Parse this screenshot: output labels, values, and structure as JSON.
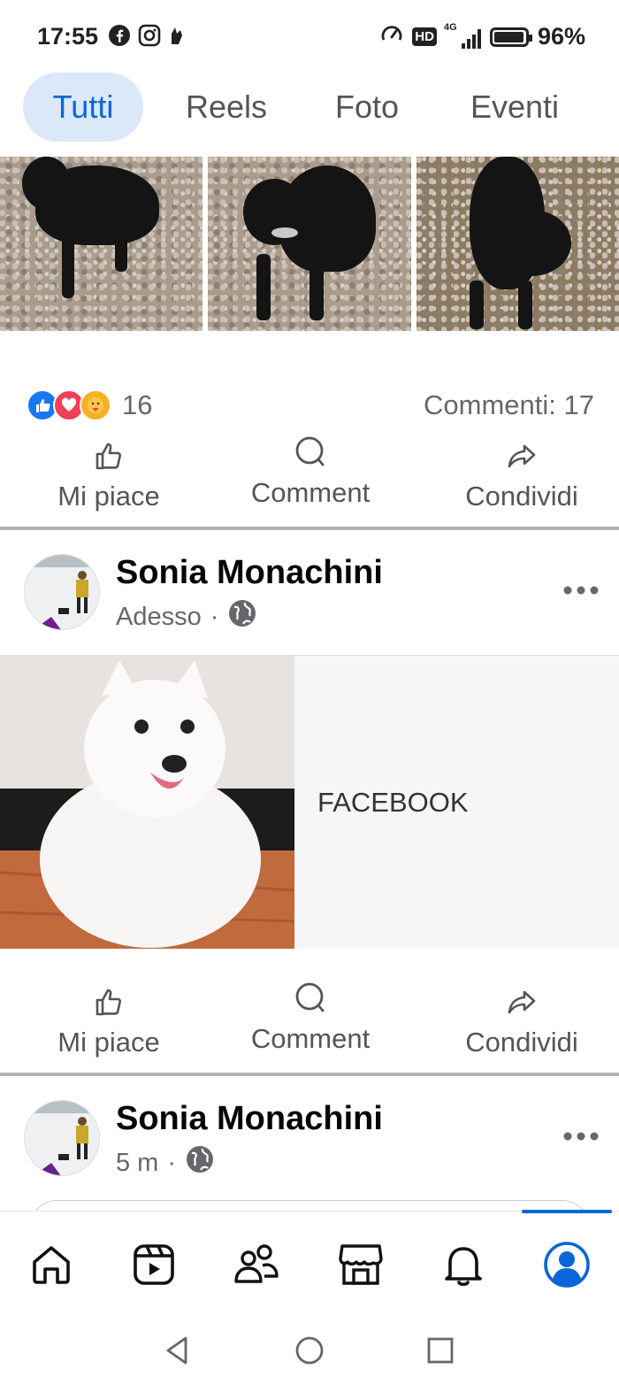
{
  "status_bar": {
    "time": "17:55",
    "battery_percent": "96%",
    "battery_level": 0.96,
    "network": "4G",
    "hd": "HD",
    "left_icons": [
      "facebook-icon",
      "instagram-icon",
      "notification-app-icon"
    ],
    "right_icons": [
      "speed-icon",
      "hd-icon",
      "signal-icon",
      "battery-icon"
    ]
  },
  "tabs": [
    {
      "label": "Tutti",
      "active": true
    },
    {
      "label": "Reels",
      "active": false
    },
    {
      "label": "Foto",
      "active": false
    },
    {
      "label": "Eventi",
      "active": false
    }
  ],
  "post1": {
    "reaction_count": "16",
    "comments": "Commenti: 17",
    "actions": {
      "like": "Mi piace",
      "comment": "Comment",
      "share": "Condividi"
    }
  },
  "post2": {
    "author": "Sonia Monachini",
    "time": "Adesso",
    "separator": "·",
    "link_text": "FACEBOOK",
    "actions": {
      "like": "Mi piace",
      "comment": "Comment",
      "share": "Condividi"
    }
  },
  "post3": {
    "author": "Sonia Monachini",
    "time": "5 m",
    "separator": "·"
  },
  "bottom_nav": {
    "items": [
      "home-icon",
      "video-icon",
      "friends-icon",
      "marketplace-icon",
      "notifications-icon",
      "profile-icon"
    ],
    "active": "profile-icon",
    "accent": "#0a66d8"
  },
  "colors": {
    "accent": "#0a66d8",
    "tab_active_bg": "#dbe8f8",
    "like": "#1877f2",
    "love": "#f33e58",
    "care": "#f7b125"
  }
}
